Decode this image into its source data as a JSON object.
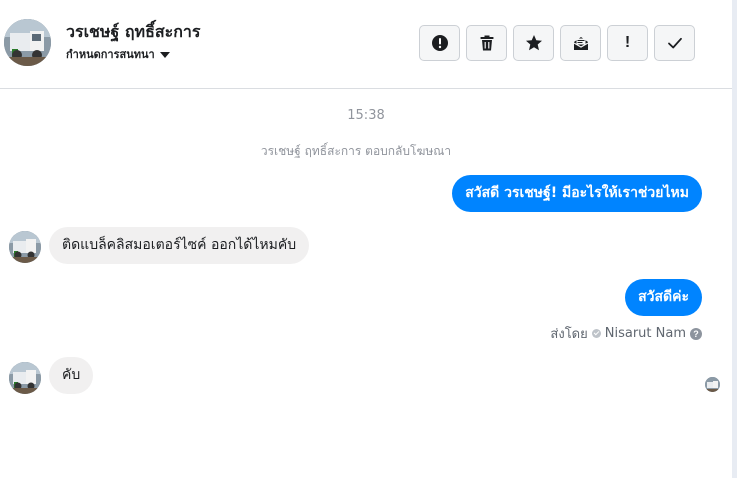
{
  "header": {
    "contact_name": "วรเชษฐ์ ฤทธิ์สะการ",
    "assign_label": "กำหนดการสนทนา",
    "toolbar": [
      {
        "icon": "exclamation-circle-icon"
      },
      {
        "icon": "trash-icon"
      },
      {
        "icon": "star-icon"
      },
      {
        "icon": "mail-unread-icon"
      },
      {
        "icon": "exclamation-icon",
        "glyph": "!"
      },
      {
        "icon": "checkmark-icon"
      }
    ]
  },
  "conversation": {
    "timestamp": "15:38",
    "system_note": "วรเชษฐ์ ฤทธิ์สะการ ตอบกลับโฆษณา",
    "messages": [
      {
        "direction": "outgoing",
        "text": "สวัสดี วรเชษฐ์! มีอะไรให้เราช่วยไหม"
      },
      {
        "direction": "incoming",
        "text": "ติดแบล็คลิสมอเตอร์ไซค์ ออกได้ไหมคับ"
      },
      {
        "direction": "outgoing",
        "text": "สวัสดีค่ะ"
      },
      {
        "direction": "incoming",
        "text": "คับ"
      }
    ],
    "sent_by": {
      "prefix": "ส่งโดย",
      "name": "Nisarut Nam"
    }
  },
  "colors": {
    "outgoing_bubble": "#0084ff",
    "incoming_bubble": "#f1f0f0",
    "muted_text": "#90949c",
    "divider": "#dadde1"
  }
}
